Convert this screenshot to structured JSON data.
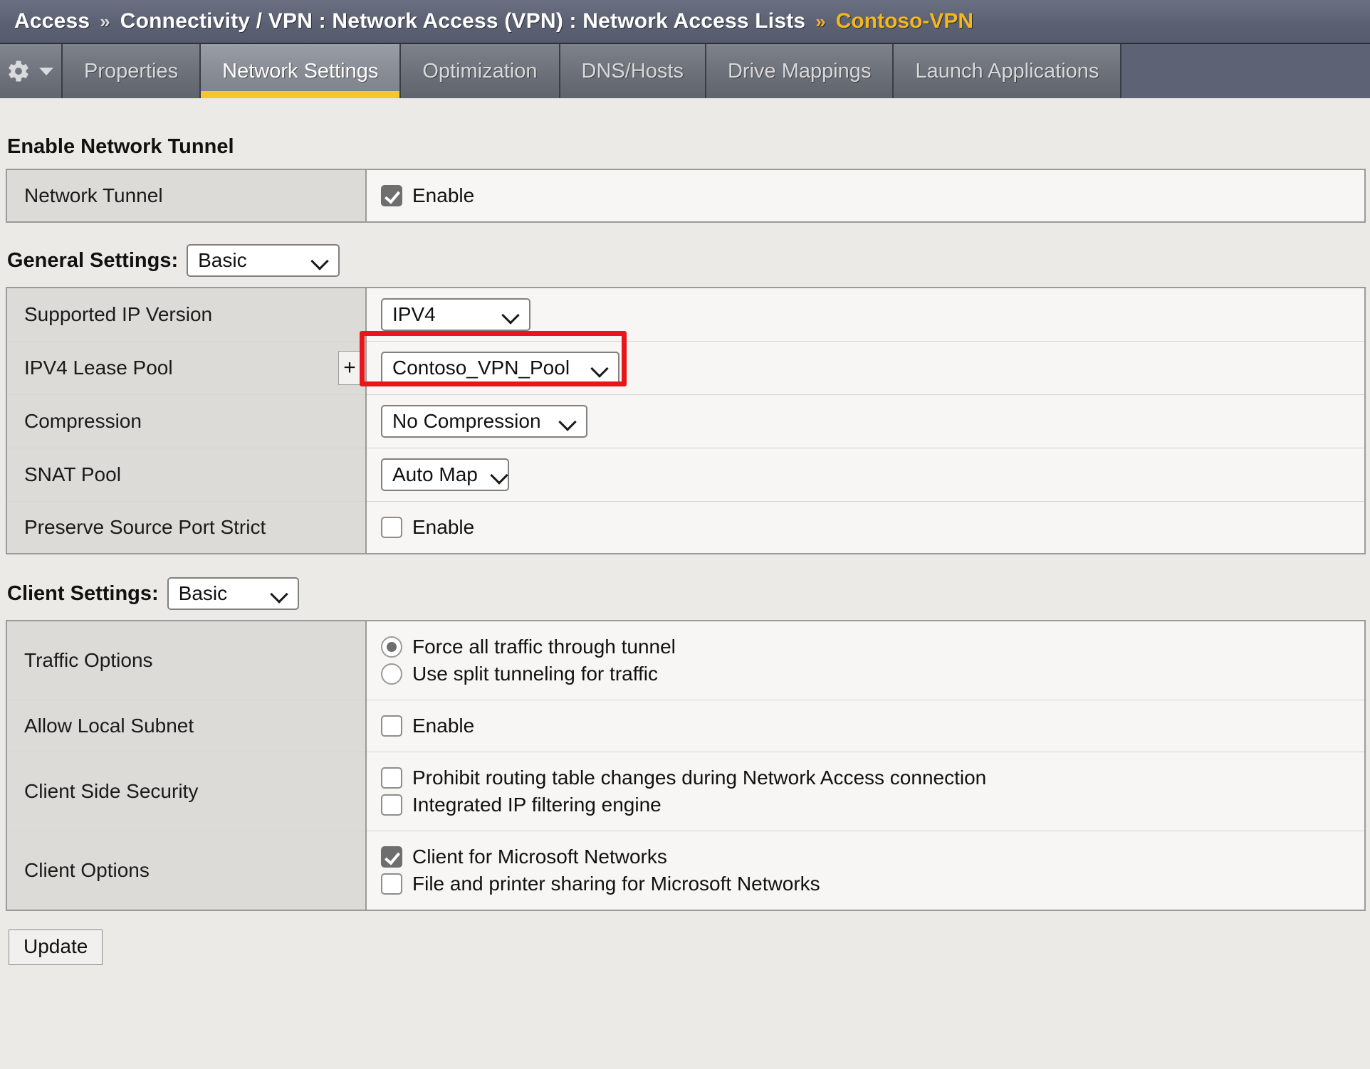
{
  "breadcrumb": {
    "root": "Access",
    "sep": "»",
    "path": "Connectivity / VPN : Network Access (VPN) : Network Access Lists",
    "current": "Contoso-VPN"
  },
  "tabbar": {
    "gear_icon": "gear-icon",
    "caret_icon": "chevron-down-icon",
    "tabs": [
      {
        "label": "Properties",
        "active": false
      },
      {
        "label": "Network Settings",
        "active": true
      },
      {
        "label": "Optimization",
        "active": false
      },
      {
        "label": "DNS/Hosts",
        "active": false
      },
      {
        "label": "Drive Mappings",
        "active": false
      },
      {
        "label": "Launch Applications",
        "active": false
      }
    ]
  },
  "enable_network_tunnel": {
    "heading": "Enable Network Tunnel",
    "row_label": "Network Tunnel",
    "checkbox_label": "Enable",
    "checked": true
  },
  "general_settings": {
    "heading": "General Settings:",
    "mode": "Basic",
    "rows": {
      "supported_ip_version": {
        "label": "Supported IP Version",
        "value": "IPV4"
      },
      "ipv4_lease_pool": {
        "label": "IPV4 Lease Pool",
        "add_button": "+",
        "value": "Contoso_VPN_Pool",
        "highlight_color": "#e8161a"
      },
      "compression": {
        "label": "Compression",
        "value": "No Compression"
      },
      "snat_pool": {
        "label": "SNAT Pool",
        "value": "Auto Map"
      },
      "preserve_source_port_strict": {
        "label": "Preserve Source Port Strict",
        "checkbox_label": "Enable",
        "checked": false
      }
    }
  },
  "client_settings": {
    "heading": "Client Settings:",
    "mode": "Basic",
    "traffic_options": {
      "label": "Traffic Options",
      "option_force": "Force all traffic through tunnel",
      "option_split": "Use split tunneling for traffic",
      "selected": "force"
    },
    "allow_local_subnet": {
      "label": "Allow Local Subnet",
      "checkbox_label": "Enable",
      "checked": false
    },
    "client_side_security": {
      "label": "Client Side Security",
      "option_prohibit": "Prohibit routing table changes during Network Access connection",
      "option_prohibit_checked": false,
      "option_filtering": "Integrated IP filtering engine",
      "option_filtering_checked": false
    },
    "client_options": {
      "label": "Client Options",
      "option_client_ms": "Client for Microsoft Networks",
      "option_client_ms_checked": true,
      "option_file_print": "File and printer sharing for Microsoft Networks",
      "option_file_print_checked": false
    }
  },
  "footer": {
    "update_label": "Update"
  }
}
